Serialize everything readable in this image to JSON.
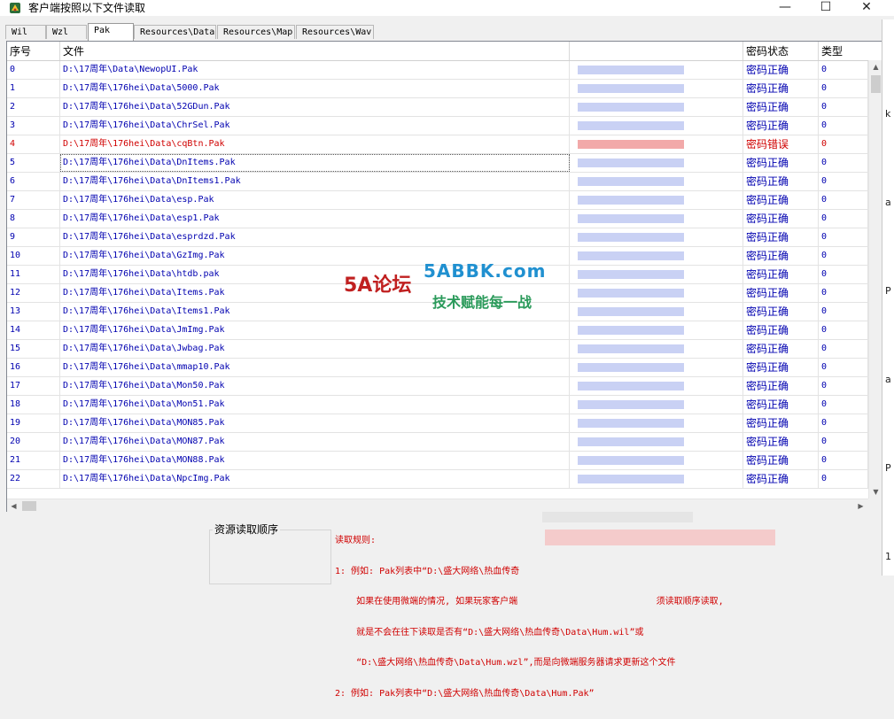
{
  "window": {
    "title": "客户端按照以下文件读取",
    "min_glyph": "—",
    "max_glyph": "☐",
    "close_glyph": "✕"
  },
  "tabs": [
    {
      "label": "Wil",
      "active": false
    },
    {
      "label": "Wzl",
      "active": false
    },
    {
      "label": "Pak",
      "active": true
    },
    {
      "label": "Resources\\Data",
      "active": false
    },
    {
      "label": "Resources\\Map",
      "active": false
    },
    {
      "label": "Resources\\Wav",
      "active": false
    }
  ],
  "table": {
    "columns": [
      "序号",
      "文件",
      "",
      "密码状态",
      "类型"
    ],
    "rows": [
      {
        "idx": "0",
        "file": "D:\\17周年\\Data\\NewopUI.Pak",
        "status": "密码正确",
        "type": "0"
      },
      {
        "idx": "1",
        "file": "D:\\17周年\\176hei\\Data\\5000.Pak",
        "status": "密码正确",
        "type": "0"
      },
      {
        "idx": "2",
        "file": "D:\\17周年\\176hei\\Data\\52GDun.Pak",
        "status": "密码正确",
        "type": "0"
      },
      {
        "idx": "3",
        "file": "D:\\17周年\\176hei\\Data\\ChrSel.Pak",
        "status": "密码正确",
        "type": "0"
      },
      {
        "idx": "4",
        "file": "D:\\17周年\\176hei\\Data\\cqBtn.Pak",
        "status": "密码错误",
        "type": "0",
        "error": true
      },
      {
        "idx": "5",
        "file": "D:\\17周年\\176hei\\Data\\DnItems.Pak",
        "status": "密码正确",
        "type": "0",
        "selected": true
      },
      {
        "idx": "6",
        "file": "D:\\17周年\\176hei\\Data\\DnItems1.Pak",
        "status": "密码正确",
        "type": "0"
      },
      {
        "idx": "7",
        "file": "D:\\17周年\\176hei\\Data\\esp.Pak",
        "status": "密码正确",
        "type": "0"
      },
      {
        "idx": "8",
        "file": "D:\\17周年\\176hei\\Data\\esp1.Pak",
        "status": "密码正确",
        "type": "0"
      },
      {
        "idx": "9",
        "file": "D:\\17周年\\176hei\\Data\\esprdzd.Pak",
        "status": "密码正确",
        "type": "0"
      },
      {
        "idx": "10",
        "file": "D:\\17周年\\176hei\\Data\\GzImg.Pak",
        "status": "密码正确",
        "type": "0"
      },
      {
        "idx": "11",
        "file": "D:\\17周年\\176hei\\Data\\htdb.pak",
        "status": "密码正确",
        "type": "0"
      },
      {
        "idx": "12",
        "file": "D:\\17周年\\176hei\\Data\\Items.Pak",
        "status": "密码正确",
        "type": "0"
      },
      {
        "idx": "13",
        "file": "D:\\17周年\\176hei\\Data\\Items1.Pak",
        "status": "密码正确",
        "type": "0"
      },
      {
        "idx": "14",
        "file": "D:\\17周年\\176hei\\Data\\JmImg.Pak",
        "status": "密码正确",
        "type": "0"
      },
      {
        "idx": "15",
        "file": "D:\\17周年\\176hei\\Data\\Jwbag.Pak",
        "status": "密码正确",
        "type": "0"
      },
      {
        "idx": "16",
        "file": "D:\\17周年\\176hei\\Data\\mmap10.Pak",
        "status": "密码正确",
        "type": "0"
      },
      {
        "idx": "17",
        "file": "D:\\17周年\\176hei\\Data\\Mon50.Pak",
        "status": "密码正确",
        "type": "0"
      },
      {
        "idx": "18",
        "file": "D:\\17周年\\176hei\\Data\\Mon51.Pak",
        "status": "密码正确",
        "type": "0"
      },
      {
        "idx": "19",
        "file": "D:\\17周年\\176hei\\Data\\MON85.Pak",
        "status": "密码正确",
        "type": "0"
      },
      {
        "idx": "20",
        "file": "D:\\17周年\\176hei\\Data\\MON87.Pak",
        "status": "密码正确",
        "type": "0"
      },
      {
        "idx": "21",
        "file": "D:\\17周年\\176hei\\Data\\MON88.Pak",
        "status": "密码正确",
        "type": "0"
      },
      {
        "idx": "22",
        "file": "D:\\17周年\\176hei\\Data\\NpcImg.Pak",
        "status": "密码正确",
        "type": "0"
      }
    ]
  },
  "bottom": {
    "group_title": "资源读取顺序",
    "rules_lines": [
      "读取规则:",
      "1: 例如: Pak列表中“D:\\盛大网络\\热血传奇",
      "    如果在使用微端的情况, 如果玩家客户端                          须读取顺序读取,",
      "    就是不会在往下读取是否有“D:\\盛大网络\\热血传奇\\Data\\Hum.wil”或",
      "    “D:\\盛大网络\\热血传奇\\Data\\Hum.wzl”,而是向微端服务器请求更新这个文件",
      "2: 例如: Pak列表中“D:\\盛大网络\\热血传奇\\Data\\Hum.Pak”"
    ]
  },
  "watermark": {
    "brand": "5A论坛",
    "site": "5ABBK.com",
    "slogan": "技术赋能每一战"
  },
  "colors": {
    "ok_text": "#0000b0",
    "error_text": "#d00000",
    "rules_text": "#d00000"
  }
}
